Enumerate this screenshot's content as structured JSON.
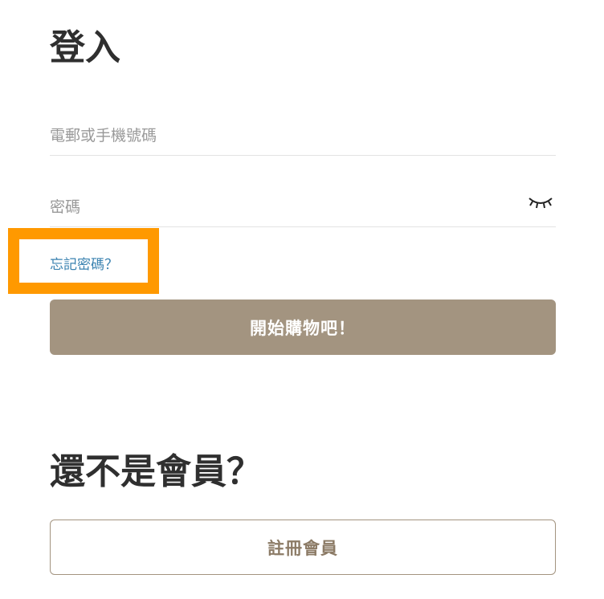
{
  "login": {
    "title": "登入",
    "email_placeholder": "電郵或手機號碼",
    "password_placeholder": "密碼",
    "password_toggle_icon": "eye-closed-icon",
    "forgot_password": "忘記密碼？",
    "submit_label": "開始購物吧！"
  },
  "signup": {
    "title": "還不是會員？",
    "register_label": "註冊會員"
  },
  "colors": {
    "primary_button": "#a39480",
    "link": "#3a82b0",
    "highlight": "#ff9900"
  }
}
